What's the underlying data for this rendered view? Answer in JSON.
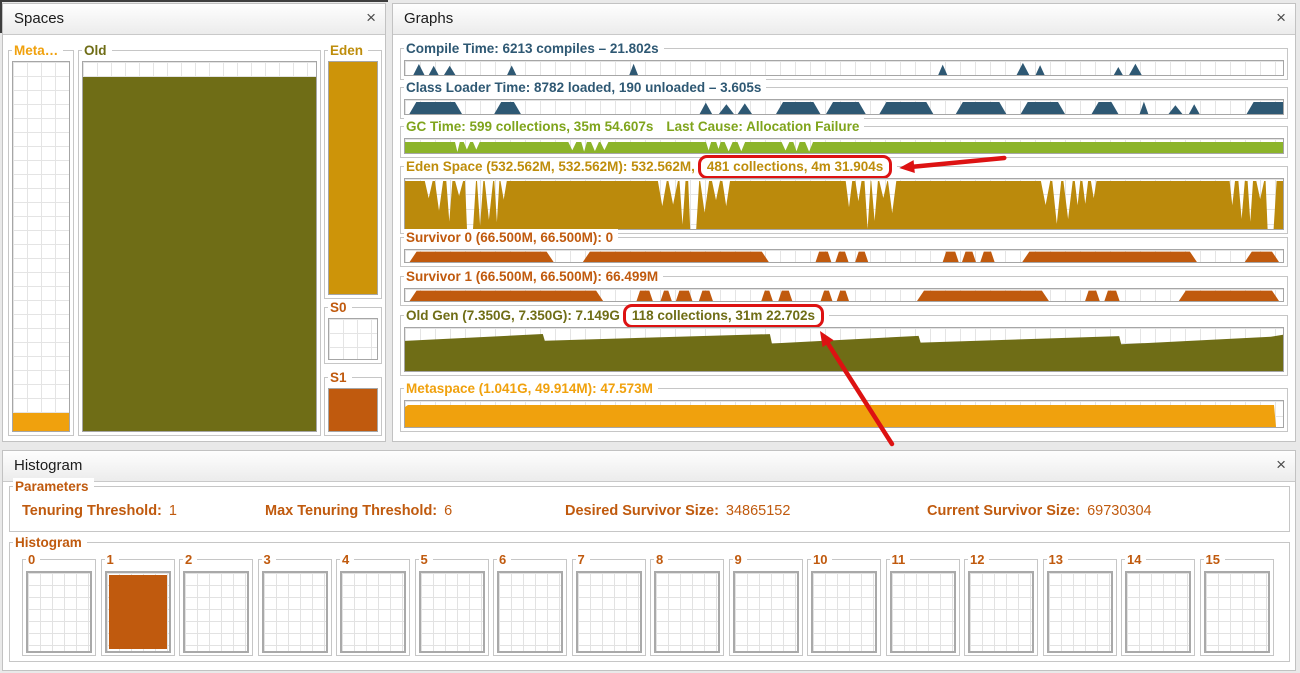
{
  "annotation_color": "#DD1212",
  "panels": {
    "spaces": {
      "title": "Spaces",
      "close": "×"
    },
    "graphs": {
      "title": "Graphs",
      "close": "×"
    },
    "histogram": {
      "title": "Histogram",
      "close": "×"
    }
  },
  "spaces": {
    "meta": {
      "label": "Meta…",
      "color": "#F0A10D",
      "fill_percent": 5
    },
    "old": {
      "label": "Old",
      "color": "#6F6D16",
      "fill_percent": 96
    },
    "eden": {
      "label": "Eden",
      "color": "#CD9409",
      "label_color": "#BE8D0B",
      "fill_percent": 100
    },
    "s0": {
      "label": "S0",
      "color": "#C05A0E",
      "fill_percent": 0
    },
    "s1": {
      "label": "S1",
      "color": "#C05A0E",
      "fill_percent": 100
    }
  },
  "graphs": {
    "rows": [
      {
        "id": "compile",
        "title": "Compile Time: 6213 compiles – 21.802s",
        "color": "#2E5873",
        "fill": "#2E5873"
      },
      {
        "id": "classloader",
        "title": "Class Loader Time: 8782 loaded, 190 unloaded – 3.605s",
        "color": "#2E5873",
        "fill": "#2E5873"
      },
      {
        "id": "gc",
        "title": "GC Time: 599 collections, 35m 54.607s",
        "last_cause": "Last Cause: Allocation Failure",
        "color": "#7FA41C",
        "fill": "#8CB42A"
      },
      {
        "id": "eden",
        "title": "Eden Space (532.562M, 532.562M): 532.562M,",
        "highlight": "481 collections, 4m 31.904s",
        "color": "#BE8D0B",
        "fill": "#BB8A0C"
      },
      {
        "id": "s0",
        "title": "Survivor 0 (66.500M, 66.500M): 0",
        "color": "#C05A0E",
        "fill": "#C05A0E"
      },
      {
        "id": "s1",
        "title": "Survivor 1 (66.500M, 66.500M): 66.499M",
        "color": "#C05A0E",
        "fill": "#C05A0E"
      },
      {
        "id": "old",
        "title": "Old Gen (7.350G, 7.350G): 7.149G",
        "highlight": "118 collections, 31m 22.702s",
        "color": "#6F6D16",
        "fill": "#6F6D16"
      },
      {
        "id": "metaspace",
        "title": "Metaspace (1.041G, 49.914M): 47.573M",
        "color": "#F0A10D",
        "fill": "#F0A10D"
      }
    ]
  },
  "histogram": {
    "parameters": {
      "group_label": "Parameters",
      "text_color": "#C05A0E",
      "items": [
        {
          "label": "Tenuring Threshold:",
          "value": "1"
        },
        {
          "label": "Max Tenuring Threshold:",
          "value": "6"
        },
        {
          "label": "Desired Survivor Size:",
          "value": "34865152"
        },
        {
          "label": "Current Survivor Size:",
          "value": "69730304"
        }
      ]
    },
    "bins": {
      "group_label": "Histogram",
      "label_color": "#C05A0E",
      "labels": [
        "0",
        "1",
        "2",
        "3",
        "4",
        "5",
        "6",
        "7",
        "8",
        "9",
        "10",
        "11",
        "12",
        "13",
        "14",
        "15"
      ],
      "filled_bin": 1,
      "fill_color": "#C05A0E"
    }
  }
}
